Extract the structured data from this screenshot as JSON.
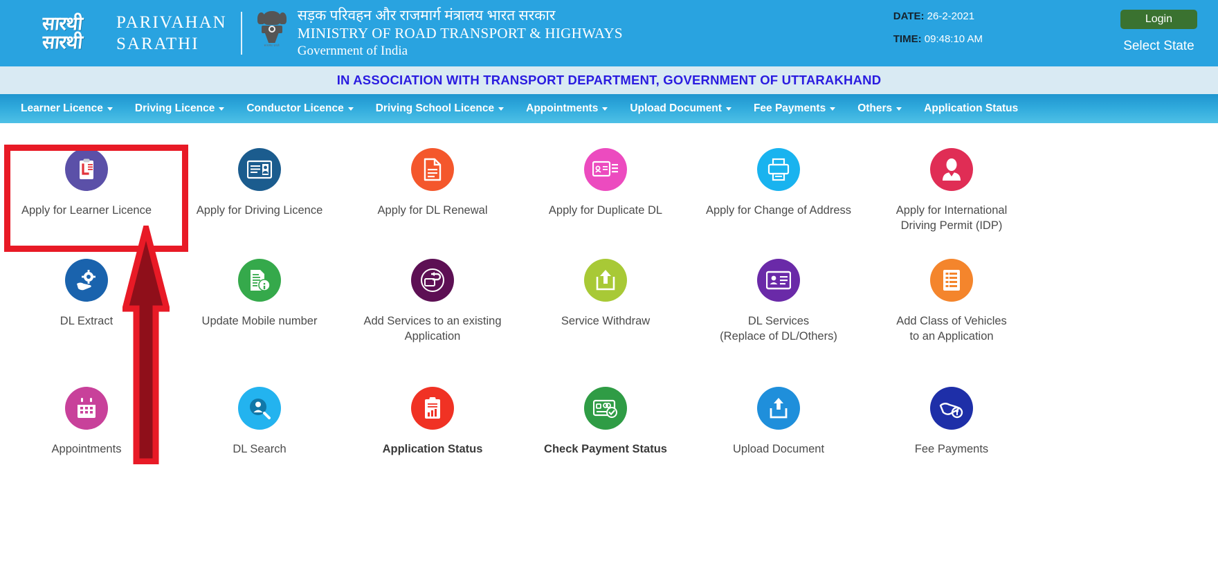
{
  "header": {
    "logo": {
      "hindi_top": "सारथी",
      "hindi_bottom": "सारथी",
      "name_line1": "PARIVAHAN",
      "name_line2": "SARATHI"
    },
    "ministry": {
      "hindi": "सड़क परिवहन और राजमार्ग मंत्रालय भारत सरकार",
      "english": "MINISTRY OF ROAD TRANSPORT & HIGHWAYS",
      "government": "Government of India",
      "emblem_motto": "सत्यमेव जयते"
    },
    "date_label": "DATE:",
    "date_value": "26-2-2021",
    "time_label": "TIME:",
    "time_value": "09:48:10 AM",
    "login_label": "Login",
    "select_state_label": "Select State",
    "bg_color": "#29a3e0",
    "login_color": "#3a7230"
  },
  "association": {
    "text": "IN ASSOCIATION WITH TRANSPORT DEPARTMENT, GOVERNMENT OF UTTARAKHAND",
    "text_color": "#2a1ce0",
    "bg_color": "#d9eaf3"
  },
  "nav": {
    "items": [
      {
        "label": "Learner Licence",
        "has_caret": true
      },
      {
        "label": "Driving Licence",
        "has_caret": true
      },
      {
        "label": "Conductor Licence",
        "has_caret": true
      },
      {
        "label": "Driving School Licence",
        "has_caret": true
      },
      {
        "label": "Appointments",
        "has_caret": true
      },
      {
        "label": "Upload Document",
        "has_caret": true
      },
      {
        "label": "Fee Payments",
        "has_caret": true
      },
      {
        "label": "Others",
        "has_caret": true
      },
      {
        "label": "Application Status",
        "has_caret": false
      }
    ]
  },
  "tiles": {
    "row1": [
      {
        "label": "Apply for Learner Licence",
        "icon": "clipboard-l-icon",
        "color": "#5b50a8",
        "bold": false,
        "highlighted": true
      },
      {
        "label": "Apply for Driving Licence",
        "icon": "id-card-icon",
        "color": "#1b5c8e",
        "bold": false,
        "highlighted": false
      },
      {
        "label": "Apply for DL Renewal",
        "icon": "document-renewal-icon",
        "color": "#f4572c",
        "bold": false,
        "highlighted": false
      },
      {
        "label": "Apply for Duplicate DL",
        "icon": "duplicate-card-icon",
        "color": "#ec4bbf",
        "bold": false,
        "highlighted": false
      },
      {
        "label": "Apply for Change of Address",
        "icon": "printer-address-icon",
        "color": "#19b3ef",
        "bold": false,
        "highlighted": false
      },
      {
        "label": "Apply for International\nDriving Permit (IDP)",
        "icon": "person-badge-icon",
        "color": "#e02d55",
        "bold": false,
        "highlighted": false
      }
    ],
    "row2": [
      {
        "label": "DL Extract",
        "icon": "hand-gear-icon",
        "color": "#1a63ad",
        "bold": false,
        "highlighted": false
      },
      {
        "label": "Update Mobile number",
        "icon": "document-info-icon",
        "color": "#35a94b",
        "bold": false,
        "highlighted": false
      },
      {
        "label": "Add Services to an existing Application",
        "icon": "add-service-icon",
        "color": "#5d1054",
        "bold": false,
        "highlighted": false
      },
      {
        "label": "Service Withdraw",
        "icon": "withdraw-upload-icon",
        "color": "#a8c936",
        "bold": false,
        "highlighted": false
      },
      {
        "label": "DL Services\n(Replace of DL/Others)",
        "icon": "dl-services-card-icon",
        "color": "#6a2aa8",
        "bold": false,
        "highlighted": false
      },
      {
        "label": "Add Class of Vehicles\nto an Application",
        "icon": "vehicle-class-list-icon",
        "color": "#f4852c",
        "bold": false,
        "highlighted": false
      }
    ],
    "row3": [
      {
        "label": "Appointments",
        "icon": "calendar-icon",
        "color": "#c8419a",
        "bold": false,
        "highlighted": false
      },
      {
        "label": "DL Search",
        "icon": "person-search-icon",
        "color": "#23b3ef",
        "bold": false,
        "highlighted": false
      },
      {
        "label": "Application Status",
        "icon": "clipboard-chart-icon",
        "color": "#f03224",
        "bold": true,
        "highlighted": false
      },
      {
        "label": "Check Payment Status",
        "icon": "payment-card-check-icon",
        "color": "#2f9c45",
        "bold": true,
        "highlighted": false
      },
      {
        "label": "Upload Document",
        "icon": "upload-box-icon",
        "color": "#1f8fdb",
        "bold": false,
        "highlighted": false
      },
      {
        "label": "Fee Payments",
        "icon": "hand-coin-icon",
        "color": "#1e2fa8",
        "bold": false,
        "highlighted": false
      }
    ]
  },
  "annotations": {
    "highlight_box": {
      "color": "#e81a26",
      "target": "Apply for Learner Licence"
    },
    "arrow": {
      "outline_color": "#e81a26",
      "fill_color": "#8f0f1a",
      "direction": "up",
      "points_to": "Apply for Learner Licence"
    }
  }
}
